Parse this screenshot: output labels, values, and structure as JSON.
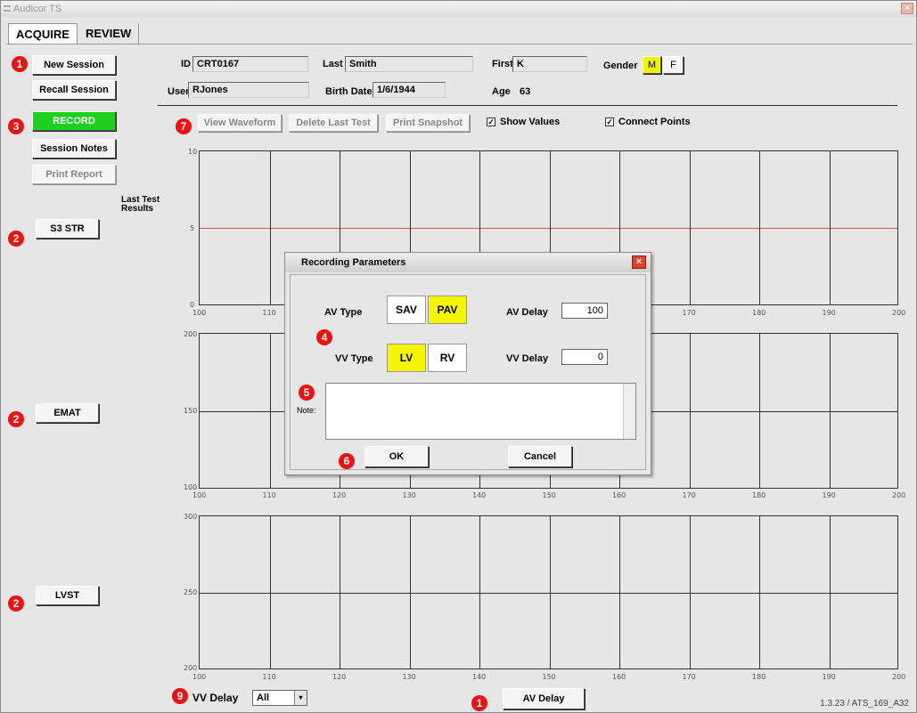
{
  "window": {
    "title": "Audicor TS",
    "close_glyph": "×"
  },
  "tabs": [
    {
      "label": "ACQUIRE",
      "active": true
    },
    {
      "label": "REVIEW",
      "active": false
    }
  ],
  "markers": {
    "m1": "1",
    "m2": "2",
    "m3": "3",
    "m4": "4",
    "m5": "5",
    "m6": "6",
    "m7": "7",
    "m9": "9"
  },
  "left_buttons": {
    "new_session": "New Session",
    "recall_session": "Recall Session",
    "record": "RECORD",
    "session_notes": "Session Notes",
    "print_report": "Print Report",
    "last_test_results": "Last Test Results",
    "s3_str": "S3 STR",
    "emat": "EMAT",
    "lvst": "LVST"
  },
  "patient": {
    "id_label": "ID",
    "id": "CRT0167",
    "last_label": "Last",
    "last": "Smith",
    "first_label": "First",
    "first": "K",
    "gender_label": "Gender",
    "gender_m": "M",
    "gender_f": "F",
    "gender_selected": "M",
    "user_label": "User",
    "user": "RJones",
    "birth_label": "Birth Date",
    "birth": "1/6/1944",
    "age_label": "Age",
    "age": "63"
  },
  "toolbar": {
    "view_waveform": "View Waveform",
    "delete_last_test": "Delete Last Test",
    "print_snapshot": "Print Snapshot",
    "show_values": "Show Values",
    "connect_points": "Connect Points",
    "check_glyph": "✓"
  },
  "charts": {
    "x_ticks": [
      "100",
      "110",
      "120",
      "130",
      "140",
      "150",
      "160",
      "170",
      "180",
      "190",
      "200"
    ],
    "chart1": {
      "y_top": "10",
      "y_mid": "5",
      "y_bottom": "0"
    },
    "chart2": {
      "y_top": "200",
      "y_mid": "150",
      "y_bottom": "100"
    },
    "chart3": {
      "y_top": "300",
      "y_mid": "250",
      "y_bottom": "200"
    }
  },
  "chart_data": [
    {
      "type": "line",
      "title": "S3 STR",
      "xlim": [
        100,
        200
      ],
      "ylim": [
        0,
        10
      ],
      "x_ticks": [
        100,
        110,
        120,
        130,
        140,
        150,
        160,
        170,
        180,
        190,
        200
      ],
      "y_ticks": [
        0,
        5,
        10
      ],
      "reference_line": {
        "y": 5,
        "color": "#e24b4b"
      },
      "series": []
    },
    {
      "type": "line",
      "title": "EMAT",
      "xlim": [
        100,
        200
      ],
      "ylim": [
        100,
        200
      ],
      "x_ticks": [
        100,
        110,
        120,
        130,
        140,
        150,
        160,
        170,
        180,
        190,
        200
      ],
      "y_ticks": [
        100,
        150,
        200
      ],
      "series": []
    },
    {
      "type": "line",
      "title": "LVST",
      "xlim": [
        100,
        200
      ],
      "ylim": [
        200,
        300
      ],
      "x_ticks": [
        100,
        110,
        120,
        130,
        140,
        150,
        160,
        170,
        180,
        190,
        200
      ],
      "y_ticks": [
        200,
        250,
        300
      ],
      "series": []
    }
  ],
  "dialog": {
    "title": "Recording Parameters",
    "close_glyph": "×",
    "av_type_label": "AV Type",
    "sav": "SAV",
    "pav": "PAV",
    "av_selected": "PAV",
    "av_delay_label": "AV Delay",
    "av_delay": "100",
    "vv_type_label": "VV Type",
    "lv": "LV",
    "rv": "RV",
    "vv_selected": "LV",
    "vv_delay_label": "VV Delay",
    "vv_delay": "0",
    "note_label": "Note:",
    "note_value": "",
    "ok": "OK",
    "cancel": "Cancel"
  },
  "bottom": {
    "vv_delay_label": "VV Delay",
    "vv_delay_value": "All",
    "dropdown_glyph": "▾",
    "av_delay_button": "AV Delay",
    "version": "1.3.23 / ATS_169_A32"
  }
}
